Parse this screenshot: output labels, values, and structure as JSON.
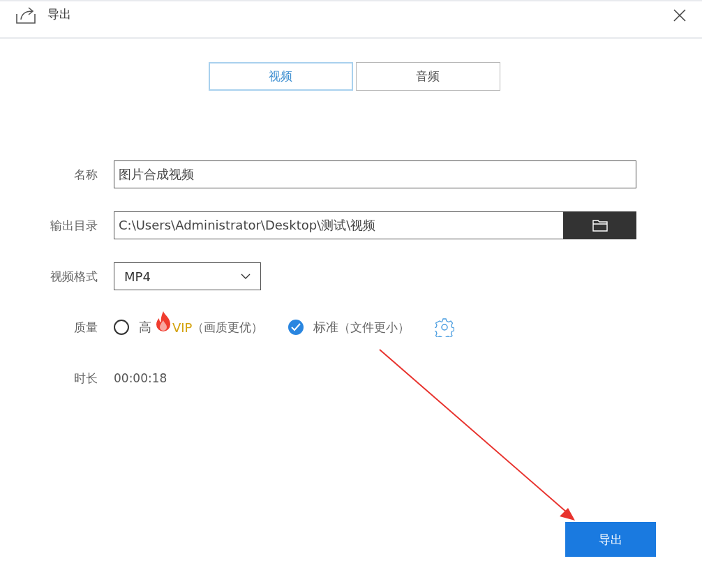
{
  "window": {
    "title": "导出"
  },
  "tabs": [
    {
      "label": "视频",
      "selected": true
    },
    {
      "label": "音频",
      "selected": false
    }
  ],
  "form": {
    "name": {
      "label": "名称",
      "value": "图片合成视频"
    },
    "output_dir": {
      "label": "输出目录",
      "value": "C:\\Users\\Administrator\\Desktop\\测试\\视频"
    },
    "format": {
      "label": "视频格式",
      "value": "MP4"
    },
    "quality": {
      "label": "质量",
      "options": [
        {
          "label": "高",
          "vip": "VIP",
          "note": "（画质更优）",
          "selected": false
        },
        {
          "label": "标准",
          "note": "（文件更小）",
          "selected": true
        }
      ]
    },
    "duration": {
      "label": "时长",
      "value": "00:00:18"
    }
  },
  "buttons": {
    "export": "导出"
  }
}
